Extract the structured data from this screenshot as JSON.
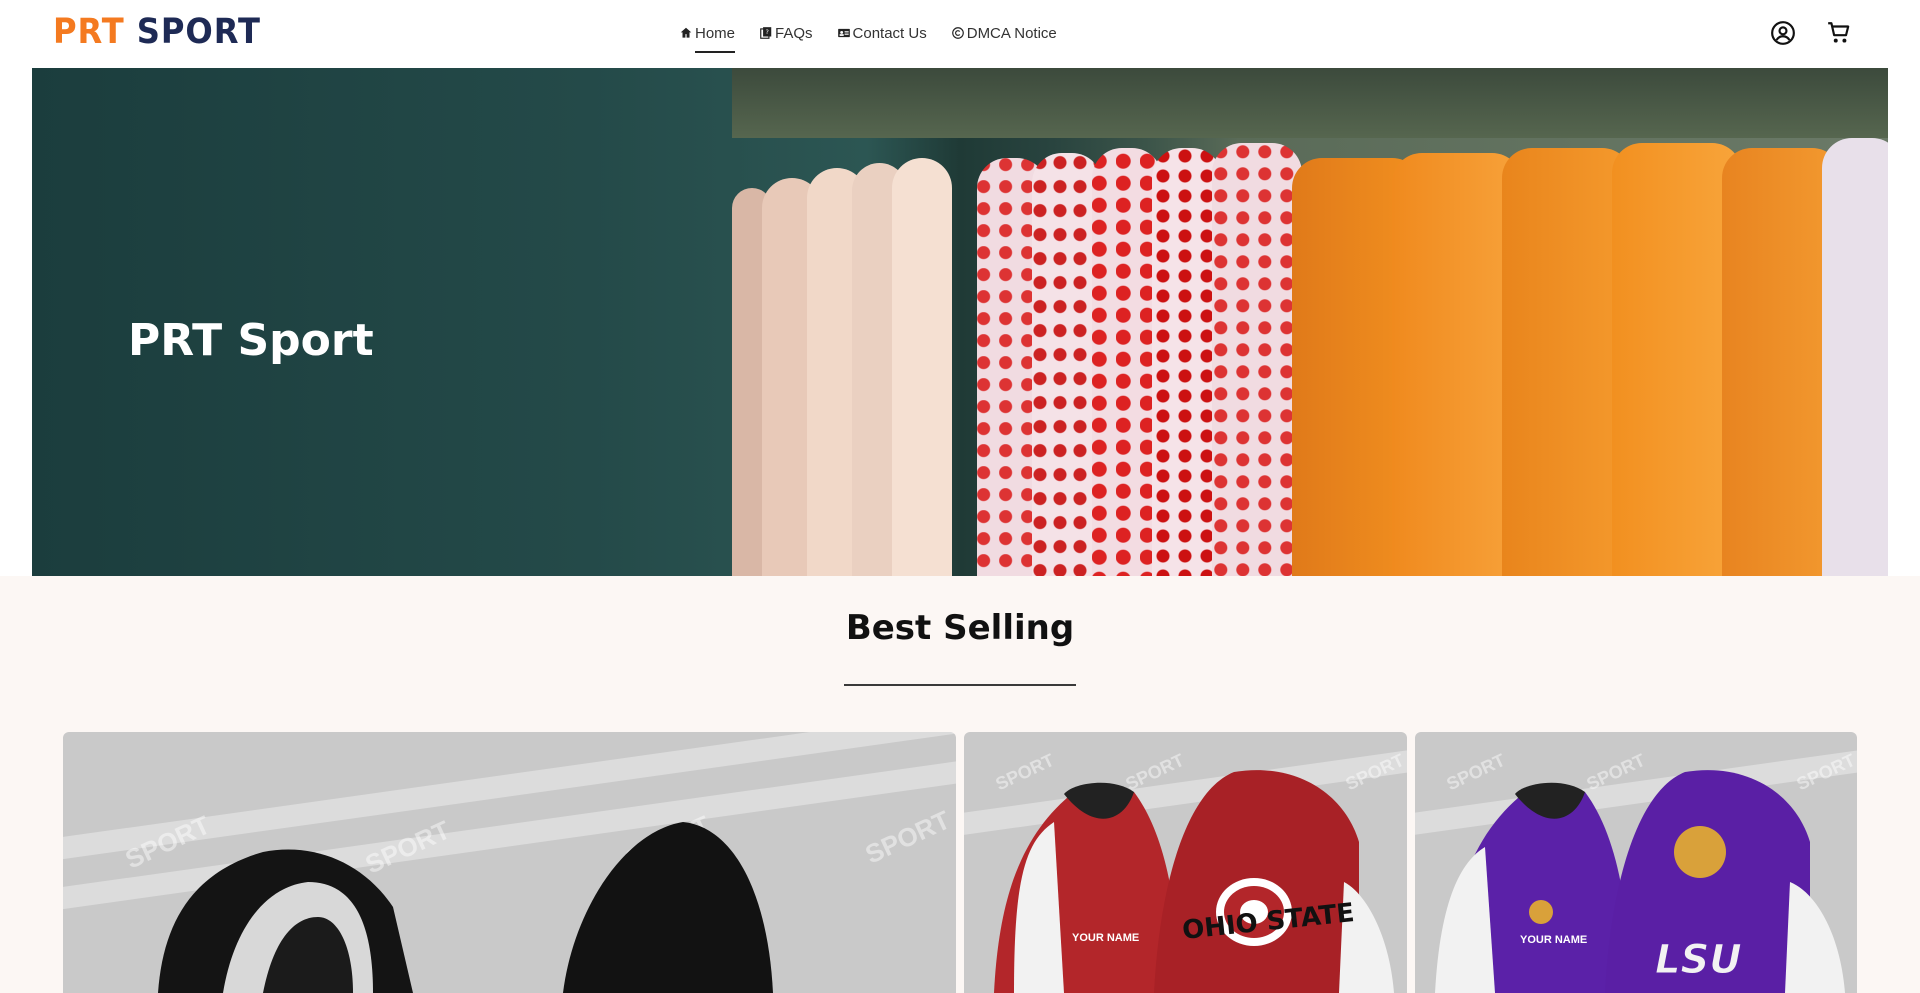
{
  "brand": {
    "part1": "PRT",
    "part2": "SPORT"
  },
  "nav": [
    {
      "label": "Home",
      "icon": "home-icon"
    },
    {
      "label": "FAQs",
      "icon": "faq-icon"
    },
    {
      "label": "Contact Us",
      "icon": "contact-card-icon"
    },
    {
      "label": "DMCA Notice",
      "icon": "copyright-icon"
    }
  ],
  "header_icons": [
    "account-icon",
    "cart-icon"
  ],
  "hero": {
    "title": "PRT Sport"
  },
  "best_selling": {
    "title": "Best Selling",
    "products": [
      {
        "colors": [
          "#1a1a1a",
          "#e8e8e8"
        ]
      },
      {
        "print_text": "YOUR NAME",
        "logo_text": "OHIO STATE",
        "colors": [
          "#b3262a",
          "#f2f2f2"
        ]
      },
      {
        "print_text": "YOUR NAME",
        "logo_text": "LSU",
        "colors": [
          "#5b21a8",
          "#f2f2f2"
        ]
      }
    ]
  },
  "watermark": "SPORT",
  "colors": {
    "brand_orange": "#f47a20",
    "brand_navy": "#1e2a55",
    "section_bg": "#fcf7f4"
  }
}
